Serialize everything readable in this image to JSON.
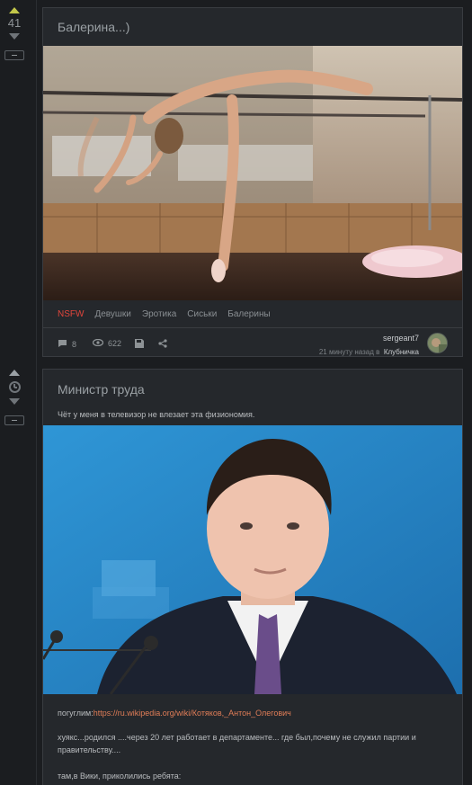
{
  "posts": [
    {
      "rating": "41",
      "title": "Балерина...)",
      "tags": [
        "NSFW",
        "Девушки",
        "Эротика",
        "Сиськи",
        "Балерины"
      ],
      "comments": "8",
      "views": "622",
      "author": "sergeant7",
      "time": "21 минуту назад в",
      "community": "Клубничка"
    },
    {
      "title": "Министр труда",
      "lead": "Чёт у меня в телевизор не влезает эта физиономия.",
      "googled_label": "погуглим:",
      "link": "https://ru.wikipedia.org/wiki/Котяков,_Антон_Олегович",
      "text1": "хуякс...родился ....через 20 лет работает в департаменте... где был,почему не служил партии и правительству....",
      "text2": "там,в Вики, приколились ребята:"
    }
  ],
  "colors": {
    "accent_up": "#c3c74a",
    "nsfw": "#e0453c",
    "link": "#e07d57"
  }
}
